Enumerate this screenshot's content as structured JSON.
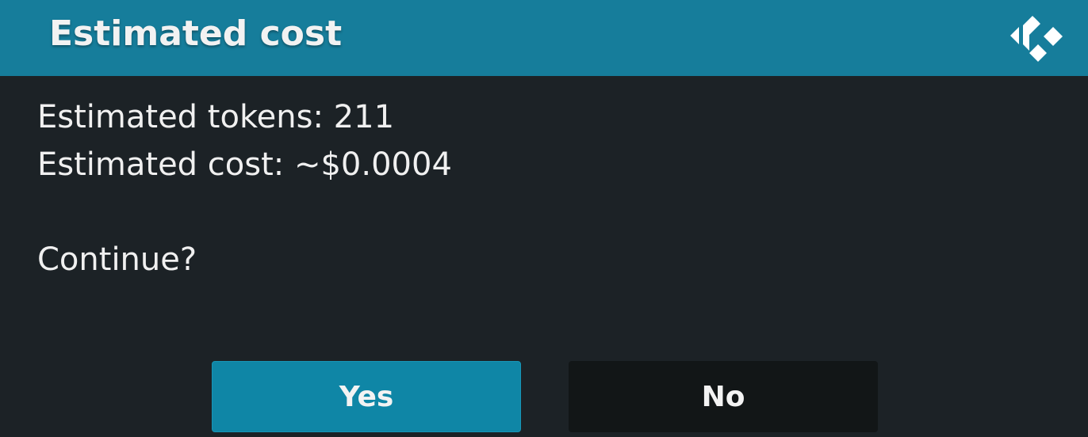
{
  "dialog": {
    "title": "Estimated cost",
    "logo_icon": "kodi-logo-icon",
    "lines": [
      "Estimated tokens: 211",
      "Estimated cost: ~$0.0004",
      "",
      "Continue?"
    ],
    "buttons": {
      "yes_label": "Yes",
      "no_label": "No"
    }
  },
  "colors": {
    "header": "#167d9b",
    "background": "#1c2226",
    "yes_button": "#0f86a6",
    "no_button": "#121617",
    "text": "#f0f0f0"
  }
}
